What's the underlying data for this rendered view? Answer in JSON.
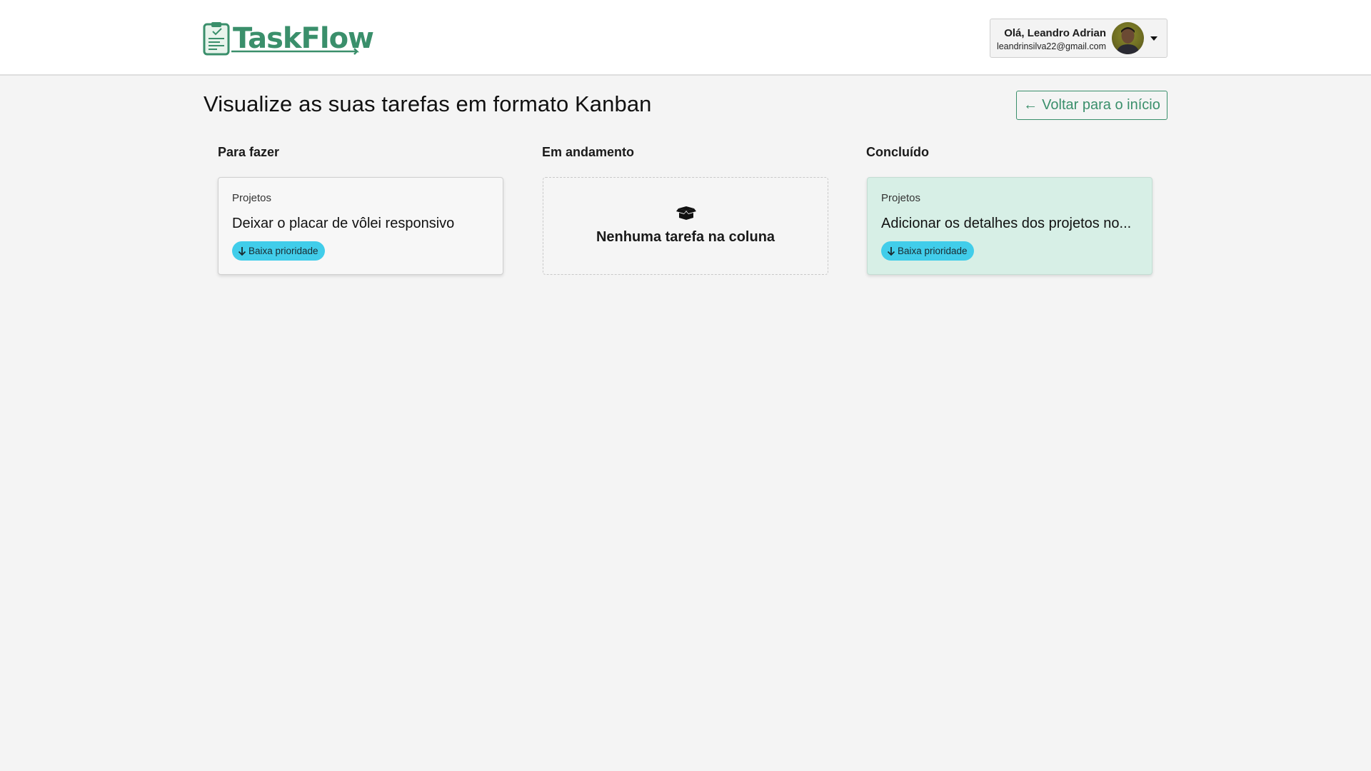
{
  "app": {
    "logo_text": "TaskFlow",
    "brand_color": "#3a8f6b"
  },
  "user": {
    "greeting": "Olá, Leandro Adrian",
    "email": "leandrinsilva22@gmail.com",
    "dropdown_icon": "caret-down-icon"
  },
  "main": {
    "title": "Visualize as suas tarefas em formato Kanban",
    "back_button": {
      "arrow": "←",
      "label": "Voltar para o início"
    }
  },
  "columns": [
    {
      "title": "Para fazer",
      "cards": [
        {
          "category": "Projetos",
          "title": "Deixar o placar de vôlei responsivo",
          "priority": "Baixa prioridade",
          "priority_color": "#41cdea"
        }
      ]
    },
    {
      "title": "Em andamento",
      "empty_text": "Nenhuma tarefa na coluna",
      "empty_icon": "box-open-icon"
    },
    {
      "title": "Concluído",
      "card_background": "#d7efe6",
      "cards": [
        {
          "category": "Projetos",
          "title": "Adicionar os detalhes dos projetos no...",
          "priority": "Baixa prioridade",
          "priority_color": "#41cdea"
        }
      ]
    }
  ]
}
